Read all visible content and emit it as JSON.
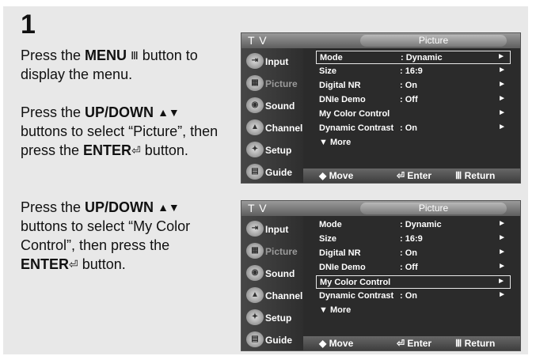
{
  "step": "1",
  "instructions": [
    {
      "pre": "Press the ",
      "bold1": "MENU",
      "icon1": "Ⅲ",
      "post": " button to display the menu."
    },
    {
      "pre": "Press the ",
      "bold1": "UP/DOWN",
      "icon1": "▲▼",
      "mid": " buttons to select “Picture”, then press the ",
      "bold2": "ENTER",
      "icon2": "⏎",
      "post": " button."
    },
    {
      "pre": "Press the ",
      "bold1": "UP/DOWN",
      "icon1": "▲▼",
      "mid": " buttons to select “My Color Control”, then press the ",
      "bold2": "ENTER",
      "icon2": "⏎",
      "post": " button."
    }
  ],
  "osd": {
    "tv_label": "T V",
    "title": "Picture",
    "sidebar": [
      "Input",
      "Picture",
      "Sound",
      "Channel",
      "Setup",
      "Guide"
    ],
    "rows": [
      {
        "key": "Mode",
        "value": ": Dynamic",
        "arrow": "►"
      },
      {
        "key": "Size",
        "value": ": 16:9",
        "arrow": "►"
      },
      {
        "key": "Digital NR",
        "value": ": On",
        "arrow": "►"
      },
      {
        "key": "DNIe Demo",
        "value": ": Off",
        "arrow": "►"
      },
      {
        "key": "My Color Control",
        "value": "",
        "arrow": "►"
      },
      {
        "key": "Dynamic Contrast",
        "value": ": On",
        "arrow": "►"
      }
    ],
    "more": "More",
    "bottom": {
      "move": "◆ Move",
      "enter": "⏎ Enter",
      "return": "Ⅲ Return"
    }
  },
  "screens": [
    {
      "selected_row": 0
    },
    {
      "selected_row": 4
    }
  ]
}
